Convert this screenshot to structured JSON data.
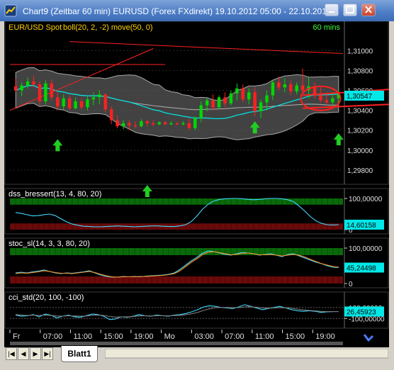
{
  "window": {
    "title": "Chart9 (Zeitbar 60 min)  EURUSD (Forex FXdirekt) 19.10.2012 05:00 - 22.10.201",
    "tab_label": "Blatt1"
  },
  "colors": {
    "background": "#000000",
    "up_bar": "#00d800",
    "down_bar": "#ff2020",
    "middle_band": "#00e8e8",
    "moving_average": "#b0b0b0",
    "band_fill": "#585858",
    "trendline": "#ff2020",
    "signal_arrow": "#22cc22",
    "overbought_zone": "#0a6a0a",
    "oversold_zone": "#6a0a0a",
    "indicator_line_1": "#40d8ff",
    "indicator_line_2": "#ff9020",
    "last_value_box": "#00e8e8"
  },
  "chart_data": [
    {
      "type": "candlestick",
      "title": "EUR/USD Spot",
      "overlays": "boll(20, 2, -2) move(50, 0)",
      "timeframe": "60 mins",
      "ylim": [
        1.297,
        1.3118
      ],
      "yticks": [
        "1,31000",
        "1,30800",
        "1,30600",
        "1,30400",
        "1,30200",
        "1,30000",
        "1,29800"
      ],
      "last_value": "1,30547",
      "x_ticks": [
        "Fr",
        "07:00",
        "11:00",
        "15:00",
        "19:00",
        "Mo",
        "03:00",
        "07:00",
        "11:00",
        "15:00",
        "19:00"
      ],
      "bars": [
        {
          "o": 1.3064,
          "h": 1.3072,
          "l": 1.3058,
          "c": 1.306
        },
        {
          "o": 1.306,
          "h": 1.3068,
          "l": 1.3054,
          "c": 1.3065
        },
        {
          "o": 1.3065,
          "h": 1.3073,
          "l": 1.3062,
          "c": 1.3069
        },
        {
          "o": 1.3069,
          "h": 1.3075,
          "l": 1.3063,
          "c": 1.3066
        },
        {
          "o": 1.3066,
          "h": 1.3069,
          "l": 1.3045,
          "c": 1.3049
        },
        {
          "o": 1.3049,
          "h": 1.307,
          "l": 1.3046,
          "c": 1.3067
        },
        {
          "o": 1.3067,
          "h": 1.3071,
          "l": 1.305,
          "c": 1.3053
        },
        {
          "o": 1.3053,
          "h": 1.3058,
          "l": 1.304,
          "c": 1.3044
        },
        {
          "o": 1.3044,
          "h": 1.3056,
          "l": 1.3041,
          "c": 1.3052
        },
        {
          "o": 1.3052,
          "h": 1.3055,
          "l": 1.304,
          "c": 1.3042
        },
        {
          "o": 1.3042,
          "h": 1.3053,
          "l": 1.3041,
          "c": 1.3049
        },
        {
          "o": 1.3049,
          "h": 1.3052,
          "l": 1.3041,
          "c": 1.3043
        },
        {
          "o": 1.3043,
          "h": 1.3054,
          "l": 1.304,
          "c": 1.3051
        },
        {
          "o": 1.3051,
          "h": 1.3058,
          "l": 1.3045,
          "c": 1.3053
        },
        {
          "o": 1.3053,
          "h": 1.306,
          "l": 1.3046,
          "c": 1.3056
        },
        {
          "o": 1.3056,
          "h": 1.3057,
          "l": 1.3038,
          "c": 1.3041
        },
        {
          "o": 1.3041,
          "h": 1.3044,
          "l": 1.3026,
          "c": 1.303
        },
        {
          "o": 1.303,
          "h": 1.3035,
          "l": 1.3022,
          "c": 1.3024
        },
        {
          "o": 1.3024,
          "h": 1.303,
          "l": 1.3021,
          "c": 1.3027
        },
        {
          "o": 1.3027,
          "h": 1.303,
          "l": 1.302,
          "c": 1.3025
        },
        {
          "o": 1.3025,
          "h": 1.3029,
          "l": 1.3022,
          "c": 1.3024
        },
        {
          "o": 1.3024,
          "h": 1.3031,
          "l": 1.3023,
          "c": 1.3029
        },
        {
          "o": 1.3029,
          "h": 1.303,
          "l": 1.3024,
          "c": 1.3027
        },
        {
          "o": 1.3027,
          "h": 1.303,
          "l": 1.3024,
          "c": 1.3026
        },
        {
          "o": 1.3026,
          "h": 1.3029,
          "l": 1.3025,
          "c": 1.3028
        },
        {
          "o": 1.3028,
          "h": 1.3029,
          "l": 1.3025,
          "c": 1.3026
        },
        {
          "o": 1.3026,
          "h": 1.3029,
          "l": 1.3025,
          "c": 1.3027
        },
        {
          "o": 1.3027,
          "h": 1.3028,
          "l": 1.3025,
          "c": 1.3026
        },
        {
          "o": 1.3026,
          "h": 1.3029,
          "l": 1.3025,
          "c": 1.3027
        },
        {
          "o": 1.3027,
          "h": 1.3032,
          "l": 1.302,
          "c": 1.3022
        },
        {
          "o": 1.3022,
          "h": 1.3034,
          "l": 1.302,
          "c": 1.3032
        },
        {
          "o": 1.3032,
          "h": 1.3049,
          "l": 1.3028,
          "c": 1.3045
        },
        {
          "o": 1.3045,
          "h": 1.3052,
          "l": 1.3039,
          "c": 1.305
        },
        {
          "o": 1.305,
          "h": 1.3056,
          "l": 1.304,
          "c": 1.3043
        },
        {
          "o": 1.3043,
          "h": 1.3055,
          "l": 1.3041,
          "c": 1.3053
        },
        {
          "o": 1.3053,
          "h": 1.3058,
          "l": 1.3043,
          "c": 1.3047
        },
        {
          "o": 1.3047,
          "h": 1.306,
          "l": 1.3045,
          "c": 1.3057
        },
        {
          "o": 1.3057,
          "h": 1.3067,
          "l": 1.305,
          "c": 1.3062
        },
        {
          "o": 1.3062,
          "h": 1.3066,
          "l": 1.3048,
          "c": 1.3051
        },
        {
          "o": 1.3051,
          "h": 1.3062,
          "l": 1.3046,
          "c": 1.3058
        },
        {
          "o": 1.3058,
          "h": 1.3063,
          "l": 1.3034,
          "c": 1.3039
        },
        {
          "o": 1.3039,
          "h": 1.3051,
          "l": 1.3032,
          "c": 1.3048
        },
        {
          "o": 1.3048,
          "h": 1.306,
          "l": 1.304,
          "c": 1.3055
        },
        {
          "o": 1.3055,
          "h": 1.307,
          "l": 1.305,
          "c": 1.3068
        },
        {
          "o": 1.3068,
          "h": 1.3074,
          "l": 1.306,
          "c": 1.3063
        },
        {
          "o": 1.3063,
          "h": 1.3072,
          "l": 1.3058,
          "c": 1.3066
        },
        {
          "o": 1.3066,
          "h": 1.307,
          "l": 1.3055,
          "c": 1.3059
        },
        {
          "o": 1.3059,
          "h": 1.3068,
          "l": 1.3056,
          "c": 1.3065
        },
        {
          "o": 1.3065,
          "h": 1.3082,
          "l": 1.3058,
          "c": 1.306
        },
        {
          "o": 1.306,
          "h": 1.3073,
          "l": 1.3052,
          "c": 1.3064
        },
        {
          "o": 1.3064,
          "h": 1.3068,
          "l": 1.3052,
          "c": 1.3055
        },
        {
          "o": 1.3055,
          "h": 1.3063,
          "l": 1.3048,
          "c": 1.305
        },
        {
          "o": 1.305,
          "h": 1.3058,
          "l": 1.3046,
          "c": 1.3048
        },
        {
          "o": 1.3048,
          "h": 1.3057,
          "l": 1.3044,
          "c": 1.3052
        },
        {
          "o": 1.3052,
          "h": 1.306,
          "l": 1.3047,
          "c": 1.3056
        }
      ],
      "signal_arrows": [
        {
          "bar": 7,
          "direction": "up",
          "price": 1.3011
        },
        {
          "bar": 22,
          "direction": "up",
          "price": 1.2965
        },
        {
          "bar": 40,
          "direction": "up",
          "price": 1.3029
        },
        {
          "bar": 54,
          "direction": "up",
          "price": 1.3017
        }
      ]
    },
    {
      "type": "line",
      "title": "dss_bressert(13, 4, 80, 20)",
      "ylim": [
        0,
        100
      ],
      "yticks": [
        "100,00000",
        "0"
      ],
      "last_value": "14,60158",
      "zones": {
        "upper": 80,
        "lower": 20
      },
      "series": [
        {
          "values": [
            55,
            52,
            48,
            44,
            45,
            48,
            50,
            45,
            35,
            25,
            18,
            14,
            11,
            10,
            9,
            9,
            10,
            11,
            12,
            11,
            10,
            9,
            10,
            11,
            12,
            12,
            11,
            10,
            10,
            12,
            16,
            26,
            44,
            66,
            82,
            92,
            97,
            99,
            100,
            100,
            99,
            97,
            96,
            97,
            99,
            100,
            100,
            99,
            96,
            90,
            76,
            60,
            42,
            28,
            20,
            16,
            15,
            16
          ]
        }
      ]
    },
    {
      "type": "line",
      "title": "stoc_sl(14, 3, 3, 80, 20)",
      "ylim": [
        0,
        100
      ],
      "yticks": [
        "100,00000",
        "0"
      ],
      "last_value": "45,24498",
      "zones": {
        "upper": 80,
        "lower": 20
      },
      "series": [
        {
          "values": [
            30,
            32,
            30,
            33,
            35,
            38,
            34,
            30,
            28,
            30,
            29,
            31,
            33,
            36,
            30,
            24,
            20,
            18,
            18,
            20,
            19,
            20,
            19,
            21,
            22,
            23,
            24,
            26,
            30,
            40,
            52,
            64,
            74,
            86,
            92,
            90,
            86,
            82,
            80,
            84,
            88,
            86,
            84,
            80,
            82,
            84,
            80,
            76,
            82,
            84,
            78,
            72,
            66,
            60,
            56,
            50,
            46,
            45
          ]
        },
        {
          "values": [
            28,
            30,
            29,
            31,
            33,
            36,
            34,
            31,
            29,
            29,
            28,
            30,
            32,
            34,
            31,
            26,
            22,
            19,
            18,
            19,
            19,
            19,
            20,
            20,
            21,
            22,
            23,
            25,
            28,
            36,
            48,
            60,
            70,
            82,
            88,
            90,
            87,
            84,
            81,
            82,
            85,
            86,
            84,
            81,
            81,
            82,
            80,
            78,
            80,
            82,
            80,
            75,
            68,
            62,
            56,
            52,
            48,
            46
          ]
        }
      ]
    },
    {
      "type": "line",
      "title": "cci_std(20, 100, -100)",
      "ylim": [
        -200,
        200
      ],
      "yticks": [
        "100,00000",
        "-100,00000"
      ],
      "last_value": "26,45923",
      "series": [
        {
          "values": [
            -40,
            -60,
            -50,
            -30,
            -70,
            -20,
            -40,
            -90,
            -60,
            -40,
            -70,
            -80,
            -50,
            -20,
            -30,
            -60,
            -120,
            -110,
            -70,
            -80,
            -60,
            -30,
            -50,
            -60,
            -40,
            -50,
            -60,
            -40,
            -30,
            -10,
            20,
            60,
            110,
            130,
            120,
            100,
            90,
            80,
            110,
            150,
            120,
            90,
            60,
            80,
            100,
            120,
            90,
            60,
            40,
            30,
            40,
            30,
            10,
            20,
            25,
            26
          ]
        },
        {
          "values": [
            -30,
            -40,
            -45,
            -40,
            -45,
            -40,
            -45,
            -55,
            -58,
            -52,
            -55,
            -60,
            -55,
            -45,
            -40,
            -45,
            -65,
            -75,
            -72,
            -72,
            -66,
            -54,
            -52,
            -54,
            -50,
            -50,
            -52,
            -48,
            -42,
            -32,
            -15,
            10,
            45,
            75,
            95,
            100,
            100,
            94,
            98,
            110,
            112,
            104,
            92,
            86,
            90,
            96,
            94,
            84,
            70,
            56,
            46,
            38,
            28,
            24,
            24,
            25
          ]
        }
      ]
    }
  ]
}
